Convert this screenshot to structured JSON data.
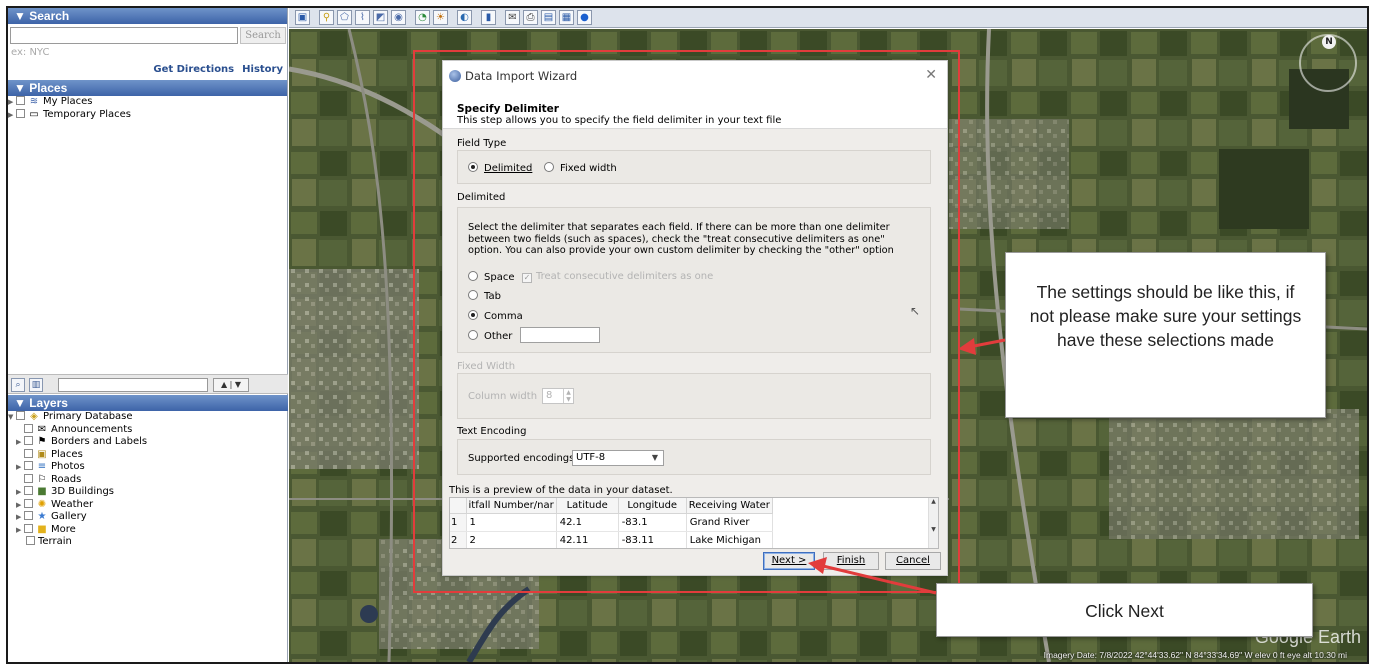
{
  "search": {
    "header": "▼ Search",
    "button": "Search",
    "hint": "ex: NYC",
    "get_directions": "Get Directions",
    "history": "History"
  },
  "places": {
    "header": "▼ Places",
    "items": [
      "My Places",
      "Temporary Places"
    ]
  },
  "layers": {
    "header": "▼ Layers",
    "items": [
      "Primary Database",
      "Announcements",
      "Borders and Labels",
      "Places",
      "Photos",
      "Roads",
      "3D Buildings",
      "Weather",
      "Gallery",
      "More",
      "Terrain"
    ]
  },
  "map": {
    "status": "Imagery Date: 7/8/2022    42°44'33.62\" N   84°33'34.69\" W   elev    0 ft     eye alt  10.30 mi",
    "watermark": "Google Earth",
    "compass_n": "N"
  },
  "dialog": {
    "title": "Data Import Wizard",
    "heading": "Specify Delimiter",
    "subheading": "This step allows you to specify the field delimiter in your text file",
    "field_type_label": "Field Type",
    "delimited_option": "Delimited",
    "fixed_width_option": "Fixed width",
    "delimited_label": "Delimited",
    "delimited_desc": "Select the delimiter that separates each field.  If there can be more than one delimiter between two fields (such as spaces), check the \"treat consecutive delimiters as one\" option.  You can also provide your own custom delimiter by checking the \"other\" option",
    "space": "Space",
    "treat_consecutive": "Treat consecutive delimiters as one",
    "tab": "Tab",
    "comma": "Comma",
    "other": "Other",
    "fixed_width_label": "Fixed Width",
    "column_width_label": "Column width",
    "column_width_value": "8",
    "text_encoding_label": "Text Encoding",
    "supported_encodings_label": "Supported encodings",
    "encoding_value": "UTF-8",
    "preview_label": "This is a preview of the data in your dataset.",
    "preview_headers": [
      "itfall Number/nar",
      "Latitude",
      "Longitude",
      "Receiving Water"
    ],
    "preview_rows": [
      {
        "n": "1",
        "cells": [
          "1",
          "42.1",
          "-83.1",
          "Grand River"
        ]
      },
      {
        "n": "2",
        "cells": [
          "2",
          "42.11",
          "-83.11",
          "Lake Michigan"
        ]
      }
    ],
    "next": "Next >",
    "finish": "Finish",
    "cancel": "Cancel"
  },
  "callouts": {
    "settings": "The settings should be like this, if not please make sure your settings have these selections made",
    "click_next": "Click Next"
  },
  "colors": {
    "highlight": "#e23c3c",
    "panel_header": "#3d63a8"
  }
}
